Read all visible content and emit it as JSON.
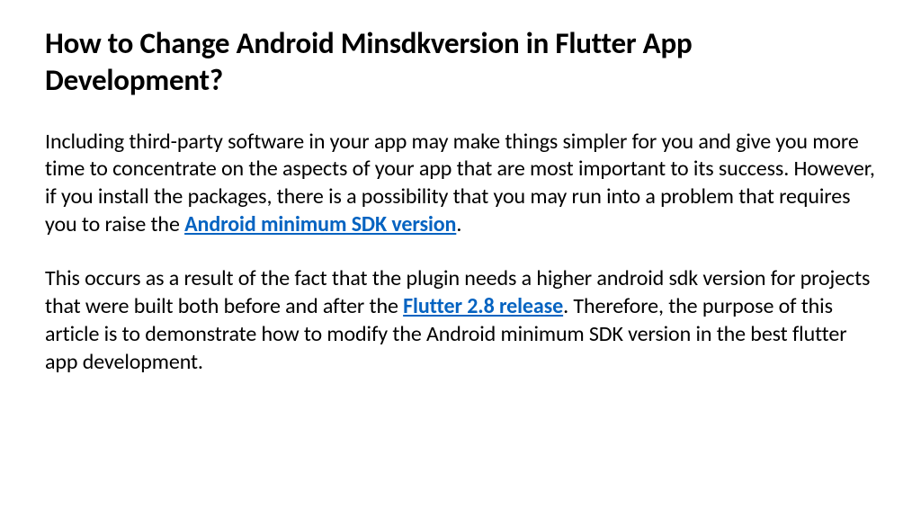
{
  "title": "How to Change Android Minsdkversion in Flutter App Development?",
  "paragraph1": {
    "text_before_link": "Including third-party software in your app may make things simpler for you and give you more time to concentrate on the aspects of your app that are most important to its success. However, if you install the packages, there is a possibility that you may run into a problem that requires you to raise the ",
    "link_text": "Android minimum SDK version",
    "text_after_link": "."
  },
  "paragraph2": {
    "text_before_link": "This occurs as a result of the fact that the plugin needs a higher android sdk version for projects that were built both before and after the ",
    "link_text": "Flutter 2.8 release",
    "text_after_link": ". Therefore, the purpose of this article is to demonstrate how to modify the Android minimum SDK version in the best flutter app development."
  }
}
